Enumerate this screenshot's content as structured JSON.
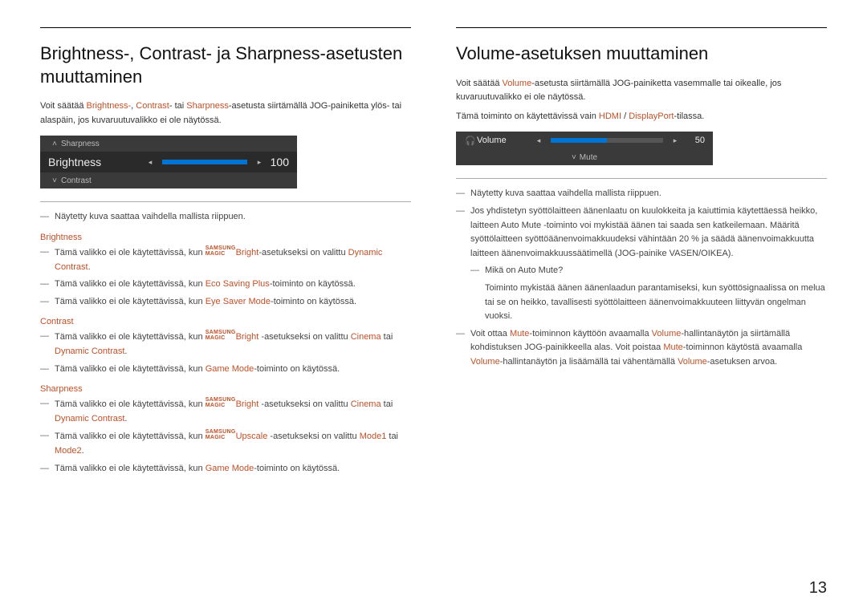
{
  "pageNumber": "13",
  "left": {
    "heading": "Brightness-, Contrast- ja Sharpness-asetusten muuttaminen",
    "intro_a": "Voit säätää ",
    "intro_b_hl": "Brightness-",
    "intro_c": ", ",
    "intro_d_hl": "Contrast",
    "intro_e": "- tai ",
    "intro_f_hl": "Sharpness",
    "intro_g": "-asetusta siirtämällä JOG-painiketta ylös- tai alaspäin, jos kuvaruutuvalikko ei ole näytössä.",
    "osd": {
      "above": "Sharpness",
      "main": "Brightness",
      "value": "100",
      "below": "Contrast",
      "fillPct": 100
    },
    "note_img": "Näytetty kuva saattaa vaihdella mallista riippuen.",
    "brightness": {
      "title": "Brightness",
      "l1_a": "Tämä valikko ei ole käytettävissä, kun ",
      "l1_magic_top": "SAMSUNG",
      "l1_magic_bot": "MAGIC",
      "l1_b_hl": "Bright",
      "l1_c": "-asetukseksi on valittu ",
      "l1_d_hl": "Dynamic Contrast",
      "l1_e": ".",
      "l2_a": "Tämä valikko ei ole käytettävissä, kun ",
      "l2_b_hl": "Eco Saving Plus",
      "l2_c": "-toiminto on käytössä.",
      "l3_a": "Tämä valikko ei ole käytettävissä, kun ",
      "l3_b_hl": "Eye Saver Mode",
      "l3_c": "-toiminto on käytössä."
    },
    "contrast": {
      "title": "Contrast",
      "l1_a": "Tämä valikko ei ole käytettävissä, kun ",
      "l1_magic_top": "SAMSUNG",
      "l1_magic_bot": "MAGIC",
      "l1_b_hl": "Bright",
      "l1_c": " -asetukseksi on valittu ",
      "l1_d_hl": "Cinema",
      "l1_e": " tai ",
      "l1_f_hl": "Dynamic Contrast",
      "l1_g": ".",
      "l2_a": "Tämä valikko ei ole käytettävissä, kun ",
      "l2_b_hl": "Game Mode",
      "l2_c": "-toiminto on käytössä."
    },
    "sharpness": {
      "title": "Sharpness",
      "l1_a": "Tämä valikko ei ole käytettävissä, kun ",
      "l1_magic_top": "SAMSUNG",
      "l1_magic_bot": "MAGIC",
      "l1_b_hl": "Bright",
      "l1_c": " -asetukseksi on valittu ",
      "l1_d_hl": "Cinema",
      "l1_e": " tai ",
      "l1_f_hl": "Dynamic Contrast",
      "l1_g": ".",
      "l2_a": "Tämä valikko ei ole käytettävissä, kun ",
      "l2_magic_top": "SAMSUNG",
      "l2_magic_bot": "MAGIC",
      "l2_b_hl": "Upscale",
      "l2_c": " -asetukseksi on valittu ",
      "l2_d_hl": "Mode1",
      "l2_e": " tai ",
      "l2_f_hl": "Mode2",
      "l2_g": ".",
      "l3_a": "Tämä valikko ei ole käytettävissä, kun ",
      "l3_b_hl": "Game Mode",
      "l3_c": "-toiminto on käytössä."
    }
  },
  "right": {
    "heading": "Volume-asetuksen muuttaminen",
    "intro_a": "Voit säätää ",
    "intro_b_hl": "Volume",
    "intro_c": "-asetusta siirtämällä JOG-painiketta vasemmalle tai oikealle, jos kuvaruutuvalikko ei ole näytössä.",
    "hdmi_a": "Tämä toiminto on käytettävissä vain ",
    "hdmi_b_hl": "HDMI",
    "hdmi_c": " / ",
    "hdmi_d_hl": "DisplayPort",
    "hdmi_e": "-tilassa.",
    "osd": {
      "main": "Volume",
      "value": "50",
      "below": "Mute",
      "fillPct": 50
    },
    "note_img": "Näytetty kuva saattaa vaihdella mallista riippuen.",
    "n2_a": "Jos yhdistetyn syöttölaitteen äänenlaatu on kuulokkeita ja kaiuttimia käytettäessä heikko, laitteen Auto Mute -toiminto voi mykistää äänen tai saada sen katkeilemaan. Määritä syöttölaitteen syöttöäänenvoimakkuudeksi vähintään 20 % ja säädä äänenvoimakkuutta laitteen äänenvoimakkuussäätimellä (JOG-painike VASEN/OIKEA).",
    "n2_sub_q": "Mikä on Auto Mute?",
    "n2_sub_a": "Toiminto mykistää äänen äänenlaadun parantamiseksi, kun syöttösignaalissa on melua tai se on heikko, tavallisesti syöttölaitteen äänenvoimakkuuteen liittyvän ongelman vuoksi.",
    "n3_a": "Voit ottaa ",
    "n3_b_hl": "Mute",
    "n3_c": "-toiminnon käyttöön avaamalla ",
    "n3_d_hl": "Volume",
    "n3_e": "-hallintanäytön ja siirtämällä kohdistuksen JOG-painikkeella alas.",
    "n3_f": "Voit poistaa ",
    "n3_g_hl": "Mute",
    "n3_h": "-toiminnon käytöstä avaamalla ",
    "n3_i_hl": "Volume",
    "n3_j": "-hallintanäytön ja lisäämällä tai vähentämällä ",
    "n3_k_hl": "Volume",
    "n3_l": "-asetuksen arvoa."
  }
}
